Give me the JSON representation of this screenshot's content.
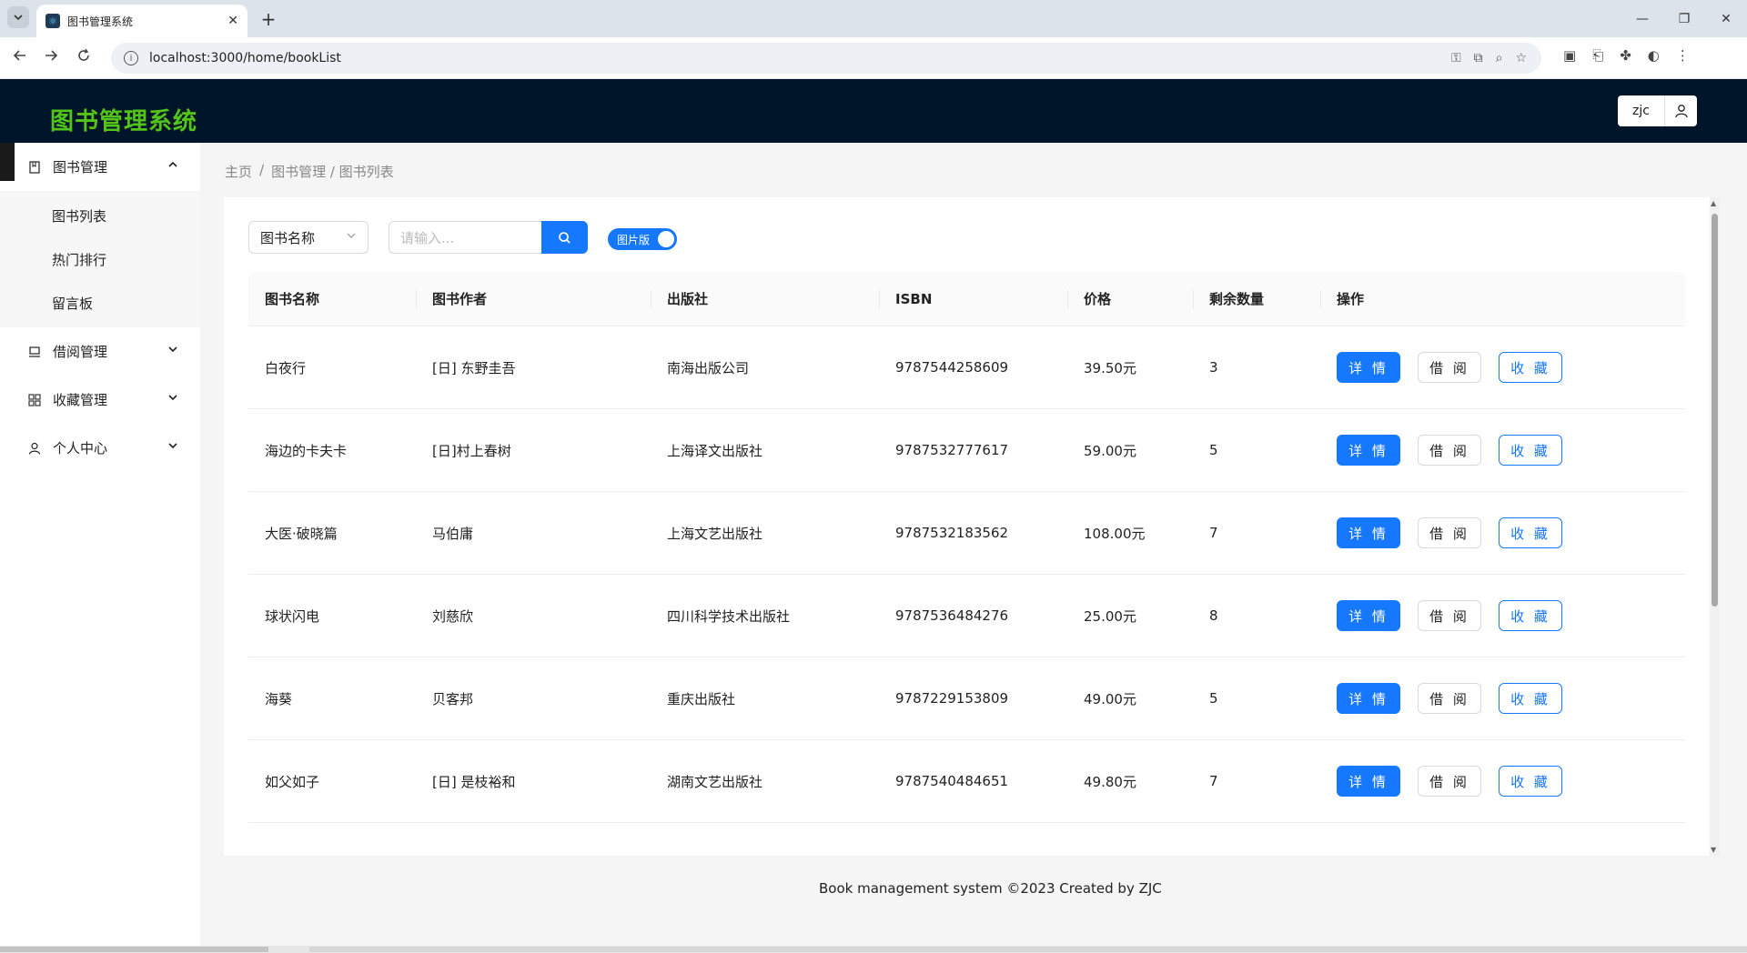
{
  "browser": {
    "tab_title": "图书管理系统",
    "tab_close": "✕",
    "new_tab": "+",
    "url": "localhost:3000/home/bookList",
    "win_minimize": "—",
    "win_restore": "❐",
    "win_close": "✕"
  },
  "header": {
    "app_title": "图书管理系统",
    "user_name": "zjc"
  },
  "sidebar": {
    "groups": [
      {
        "label": "图书管理",
        "icon": "book-icon",
        "expanded": true,
        "children": [
          {
            "label": "图书列表"
          },
          {
            "label": "热门排行"
          },
          {
            "label": "留言板"
          }
        ]
      },
      {
        "label": "借阅管理",
        "icon": "laptop-icon",
        "expanded": false
      },
      {
        "label": "收藏管理",
        "icon": "grid-icon",
        "expanded": false
      },
      {
        "label": "个人中心",
        "icon": "user-icon",
        "expanded": false
      }
    ]
  },
  "breadcrumb": {
    "home": "主页",
    "sep": "/",
    "section": "图书管理 / 图书列表"
  },
  "filter": {
    "select_value": "图书名称",
    "search_placeholder": "请输入...",
    "toggle_label": "图片版"
  },
  "table": {
    "columns": [
      "图书名称",
      "图书作者",
      "出版社",
      "ISBN",
      "价格",
      "剩余数量",
      "操作"
    ],
    "rows": [
      {
        "name": "白夜行",
        "author": "[日] 东野圭吾",
        "publisher": "南海出版公司",
        "isbn": "9787544258609",
        "price": "39.50元",
        "stock": "3"
      },
      {
        "name": "海边的卡夫卡",
        "author": "[日]村上春树",
        "publisher": "上海译文出版社",
        "isbn": "9787532777617",
        "price": "59.00元",
        "stock": "5"
      },
      {
        "name": "大医·破晓篇",
        "author": "马伯庸",
        "publisher": "上海文艺出版社",
        "isbn": "9787532183562",
        "price": "108.00元",
        "stock": "7"
      },
      {
        "name": "球状闪电",
        "author": "刘慈欣",
        "publisher": "四川科学技术出版社",
        "isbn": "9787536484276",
        "price": "25.00元",
        "stock": "8"
      },
      {
        "name": "海葵",
        "author": "贝客邦",
        "publisher": "重庆出版社",
        "isbn": "9787229153809",
        "price": "49.00元",
        "stock": "5"
      },
      {
        "name": "如父如子",
        "author": "[日] 是枝裕和",
        "publisher": "湖南文艺出版社",
        "isbn": "9787540484651",
        "price": "49.80元",
        "stock": "7"
      }
    ],
    "action_labels": {
      "detail": "详 情",
      "borrow": "借 阅",
      "favorite": "收 藏"
    }
  },
  "footer": {
    "text": "Book management system ©2023 Created by ZJC"
  },
  "colors": {
    "header_bg": "#001529",
    "title_green": "#52c41a",
    "primary": "#1677ff"
  }
}
